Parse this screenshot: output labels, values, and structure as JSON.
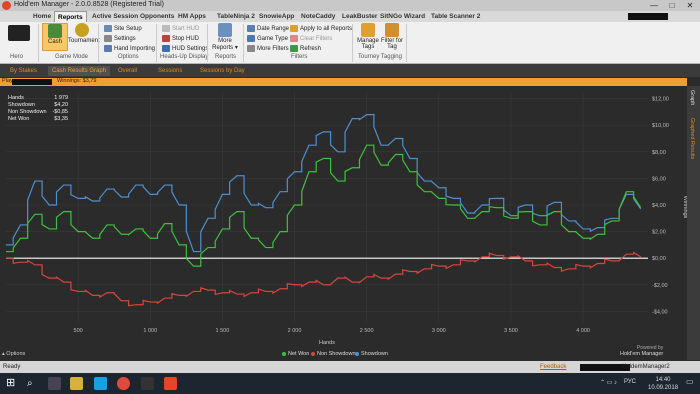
{
  "window": {
    "title": "Hold'em Manager - 2.0.0.8528 (Registered Trial)",
    "controls": [
      "—",
      "□",
      "✕"
    ]
  },
  "menu": {
    "tabs": [
      "Home",
      "Reports",
      "Active Session",
      "Opponents",
      "HM Apps",
      "TableNinja 2",
      "SnowieApp",
      "NoteCaddy",
      "LeakBuster",
      "SitNGo Wizard",
      "Table Scanner 2"
    ],
    "active": "Reports"
  },
  "ribbon": {
    "hero_label": "Hero",
    "cash": "Cash",
    "tournament": "Tournament",
    "game_mode_group": "Game Mode",
    "site_setup": "Site Setup",
    "settings": "Settings",
    "hand_importing": "Hand Importing",
    "options_group": "Options",
    "start_hud": "Start HUD",
    "stop_hud": "Stop HUD",
    "hud_settings": "HUD Settings",
    "hud_group": "Heads-Up Display",
    "more_reports": "More Reports ▾",
    "reports_group": "Reports",
    "date_range": "Date Range ▾",
    "game_type": "Game Type ▾",
    "more_filters": "More Filters",
    "apply_all": "Apply to all Reports",
    "clear_filters": "Clear Filters",
    "refresh": "Refresh",
    "filters_group": "Filters",
    "manage_tags": "Manage Tags",
    "filter_for_tag": "Filter for Tag",
    "tagging_group": "Tourney Tagging"
  },
  "subtabs": [
    "By Stakes",
    "Cash Results Graph",
    "Overall",
    "Sessions",
    "Sessions by Day"
  ],
  "subtabs_selected": "Cash Results Graph",
  "filterbar": {
    "players_label": "Players:",
    "winnings": "Winnings: $3,79"
  },
  "sidepanel": {
    "graph": "Graph",
    "graphed_results": "Graphed Results"
  },
  "stats": {
    "hands_label": "Hands",
    "hands": "1 979",
    "showdown_label": "Showdown",
    "showdown": "$4,20",
    "nonshowdown_label": "Non Showdown",
    "nonshowdown": "-$0,85",
    "netwon_label": "Net Won",
    "netwon": "$3,35"
  },
  "chart_data": {
    "type": "line",
    "xlabel": "Hands",
    "ylabel": "Winnings",
    "xlim": [
      0,
      4450
    ],
    "ylim": [
      -4.8,
      12.5
    ],
    "xticks": [
      500,
      1000,
      1500,
      2000,
      2500,
      3000,
      3500,
      4000
    ],
    "xtick_labels": [
      "500",
      "1 000",
      "1 500",
      "2 000",
      "2 500",
      "3 000",
      "3 500",
      "4 000"
    ],
    "yticks": [
      -4,
      -2,
      0,
      2,
      4,
      6,
      8,
      10,
      12
    ],
    "ytick_labels": [
      "-$4,00",
      "-$2,00",
      "$0,00",
      "$2,00",
      "$4,00",
      "$6,00",
      "$8,00",
      "$10,00",
      "$12,00"
    ],
    "series": [
      {
        "name": "Net Won",
        "color": "#3ec13e",
        "x": [
          0,
          100,
          200,
          300,
          400,
          500,
          600,
          700,
          800,
          900,
          1000,
          1100,
          1200,
          1300,
          1400,
          1500,
          1600,
          1700,
          1800,
          1900,
          2000,
          2100,
          2200,
          2300,
          2400,
          2500,
          2600,
          2700,
          2800,
          2900,
          3000,
          3100,
          3200,
          3300,
          3400,
          3500,
          3600,
          3700,
          3800,
          3900,
          4000,
          4100,
          4200,
          4300,
          4400
        ],
        "y": [
          0.5,
          1.5,
          3.3,
          2.2,
          3.5,
          2.0,
          1.5,
          2.5,
          1.8,
          2.2,
          1.5,
          2.6,
          1.0,
          -0.6,
          0.8,
          2.2,
          3.5,
          1.5,
          0.8,
          2.0,
          4.0,
          6.5,
          7.5,
          5.8,
          6.8,
          8.5,
          7.0,
          7.8,
          6.5,
          5.0,
          4.5,
          4.0,
          3.0,
          3.5,
          3.8,
          3.0,
          3.5,
          2.5,
          3.5,
          2.0,
          1.5,
          1.8,
          2.8,
          5.0,
          3.8
        ]
      },
      {
        "name": "Non Showdown",
        "color": "#d8453c",
        "x": [
          0,
          100,
          200,
          300,
          400,
          500,
          600,
          700,
          800,
          900,
          1000,
          1100,
          1200,
          1300,
          1400,
          1500,
          1600,
          1700,
          1800,
          1900,
          2000,
          2100,
          2200,
          2300,
          2400,
          2500,
          2600,
          2700,
          2800,
          2900,
          3000,
          3100,
          3200,
          3300,
          3400,
          3500,
          3600,
          3700,
          3800,
          3900,
          4000,
          4100,
          4200,
          4300,
          4400
        ],
        "y": [
          0.0,
          -0.3,
          -0.5,
          -1.5,
          -1.8,
          -2.5,
          -2.8,
          -2.6,
          -3.2,
          -3.5,
          -3.3,
          -3.0,
          -2.8,
          -2.5,
          -2.4,
          -2.6,
          -2.7,
          -2.6,
          -2.5,
          -2.3,
          -2.0,
          -1.8,
          -2.0,
          -1.5,
          -1.8,
          -1.4,
          -1.5,
          -1.2,
          -1.0,
          -0.8,
          -0.6,
          -0.5,
          -0.2,
          0.1,
          0.2,
          0.1,
          -0.2,
          -0.5,
          -0.7,
          -0.8,
          -0.6,
          -0.4,
          -0.2,
          0.3,
          0.1
        ]
      },
      {
        "name": "Showdown",
        "color": "#4f8fd0",
        "x": [
          0,
          100,
          200,
          300,
          400,
          500,
          600,
          700,
          800,
          900,
          1000,
          1100,
          1200,
          1300,
          1400,
          1500,
          1600,
          1700,
          1800,
          1900,
          2000,
          2100,
          2200,
          2300,
          2400,
          2500,
          2600,
          2700,
          2800,
          2900,
          3000,
          3100,
          3200,
          3300,
          3400,
          3500,
          3600,
          3700,
          3800,
          3900,
          4000,
          4100,
          4200,
          4300,
          4400
        ],
        "y": [
          1.0,
          2.5,
          5.8,
          4.0,
          5.5,
          4.5,
          4.3,
          5.2,
          4.6,
          5.5,
          4.8,
          5.5,
          4.0,
          0.5,
          3.0,
          4.8,
          6.2,
          4.0,
          3.8,
          5.0,
          6.5,
          8.5,
          9.5,
          8.0,
          10.5,
          10.8,
          8.5,
          9.0,
          7.5,
          5.8,
          5.3,
          4.5,
          3.4,
          4.0,
          4.5,
          3.2,
          4.0,
          3.2,
          4.2,
          2.8,
          2.2,
          2.3,
          3.0,
          4.8,
          3.7
        ]
      }
    ]
  },
  "legend": {
    "net_won": "Net Won",
    "non_showdown": "Non Showdown",
    "showdown": "Showdown"
  },
  "options_label": "Options",
  "powered_by": "Powered by",
  "powered_name": "Hold'em Manager",
  "status": {
    "ready": "Ready",
    "feedback": "Feedback",
    "version": "HoldemManager2"
  },
  "taskbar": {
    "lang": "РУС",
    "time": "14:40",
    "date": "10.09.2018"
  }
}
